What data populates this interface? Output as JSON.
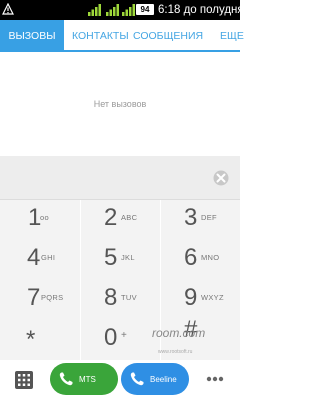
{
  "status_bar": {
    "battery": "94",
    "time": "6:18 до полудня",
    "icons": [
      "warning-icon",
      "signal-1-icon",
      "signal-2-icon",
      "wifi-icon"
    ]
  },
  "tabs": [
    {
      "label": "ВЫЗОВЫ",
      "active": true
    },
    {
      "label": "КОНТАКТЫ",
      "active": false
    },
    {
      "label": "СООБЩЕНИЯ",
      "active": false
    },
    {
      "label": "ЕЩЕ",
      "active": false
    }
  ],
  "empty_state": "Нет вызовов",
  "keypad": [
    {
      "digit": "1",
      "letters": "oo"
    },
    {
      "digit": "2",
      "letters": "ABC"
    },
    {
      "digit": "3",
      "letters": "DEF"
    },
    {
      "digit": "4",
      "letters": "GHI"
    },
    {
      "digit": "5",
      "letters": "JKL"
    },
    {
      "digit": "6",
      "letters": "MNO"
    },
    {
      "digit": "7",
      "letters": "PQRS"
    },
    {
      "digit": "8",
      "letters": "TUV"
    },
    {
      "digit": "9",
      "letters": "WXYZ"
    },
    {
      "digit": "*",
      "letters": ""
    },
    {
      "digit": "0",
      "letters": "+"
    },
    {
      "digit": "#",
      "letters": ""
    }
  ],
  "watermark": "rooт.com",
  "watermark_small": "www.rootsoft.ru",
  "calls": {
    "sim1": "MTS",
    "sim2": "Beeline"
  },
  "colors": {
    "accent": "#38a0e4",
    "sim1": "#3aa53a",
    "sim2": "#2f8fe4"
  }
}
